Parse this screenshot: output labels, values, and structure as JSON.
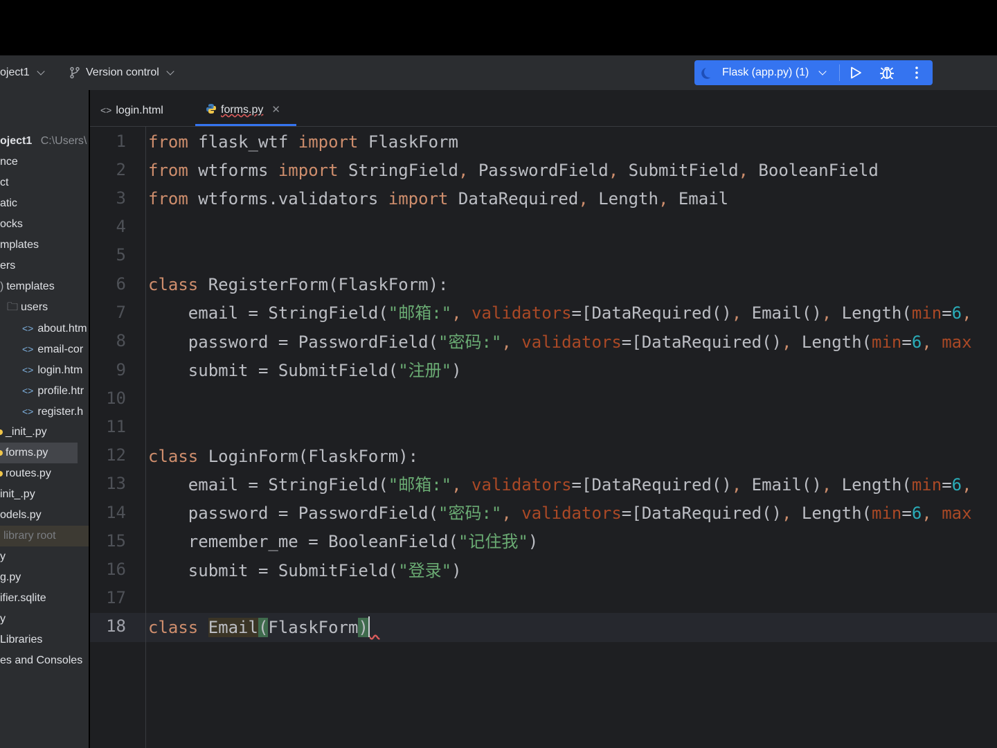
{
  "toolbar": {
    "project_label": "oject1",
    "vcs_label": "Version control",
    "run_config_label": "Flask (app.py) (1)"
  },
  "sidebar": {
    "root_label": "oject1",
    "root_path": "C:\\Users\\",
    "items": [
      {
        "label": "nce",
        "kind": "folder"
      },
      {
        "label": "ct",
        "kind": "folder"
      },
      {
        "label": "atic",
        "kind": "folder"
      },
      {
        "label": "ocks",
        "kind": "folder"
      },
      {
        "label": "mplates",
        "kind": "folder"
      },
      {
        "label": "ers",
        "kind": "folder"
      },
      {
        "label": "templates",
        "kind": "folder"
      },
      {
        "label": "users",
        "kind": "folder"
      },
      {
        "label": "about.htm",
        "kind": "html"
      },
      {
        "label": "email-cor",
        "kind": "html"
      },
      {
        "label": "login.htm",
        "kind": "html"
      },
      {
        "label": "profile.htr",
        "kind": "html"
      },
      {
        "label": "register.h",
        "kind": "html"
      },
      {
        "label": "_init_.py",
        "kind": "py"
      },
      {
        "label": "forms.py",
        "kind": "py",
        "selected": true
      },
      {
        "label": "routes.py",
        "kind": "py"
      },
      {
        "label": "init_.py",
        "kind": "py"
      },
      {
        "label": "odels.py",
        "kind": "py"
      },
      {
        "label": "library root",
        "kind": "lib"
      },
      {
        "label": "y",
        "kind": "py"
      },
      {
        "label": "g.py",
        "kind": "py"
      },
      {
        "label": "ifier.sqlite",
        "kind": "file"
      },
      {
        "label": "y",
        "kind": "py"
      },
      {
        "label": "Libraries",
        "kind": "folder"
      },
      {
        "label": "es and Consoles",
        "kind": "folder"
      }
    ]
  },
  "tabs": [
    {
      "label": "login.html",
      "active": false
    },
    {
      "label": "forms.py",
      "active": true
    }
  ],
  "editor": {
    "line_numbers": [
      "1",
      "2",
      "3",
      "4",
      "5",
      "6",
      "7",
      "8",
      "9",
      "10",
      "11",
      "12",
      "13",
      "14",
      "15",
      "16",
      "17",
      "18"
    ],
    "current_line": "18",
    "lines": [
      "from flask_wtf import FlaskForm",
      "from wtforms import StringField, PasswordField, SubmitField, BooleanField",
      "from wtforms.validators import DataRequired, Length, Email",
      "",
      "",
      "class RegisterForm(FlaskForm):",
      "    email = StringField(\"邮箱:\", validators=[DataRequired(), Email(), Length(min=6,",
      "    password = PasswordField(\"密码:\", validators=[DataRequired(), Length(min=6, max",
      "    submit = SubmitField(\"注册\")",
      "",
      "",
      "class LoginForm(FlaskForm):",
      "    email = StringField(\"邮箱:\", validators=[DataRequired(), Email(), Length(min=6,",
      "    password = PasswordField(\"密码:\", validators=[DataRequired(), Length(min=6, max",
      "    remember_me = BooleanField(\"记住我\")",
      "    submit = SubmitField(\"登录\")",
      "",
      "class Email(FlaskForm)"
    ]
  },
  "colors": {
    "keyword": "#cf8e6d",
    "string": "#6aab73",
    "param": "#aa4926",
    "number": "#2aacb8",
    "text": "#bcbec4",
    "accent": "#3574f0"
  }
}
